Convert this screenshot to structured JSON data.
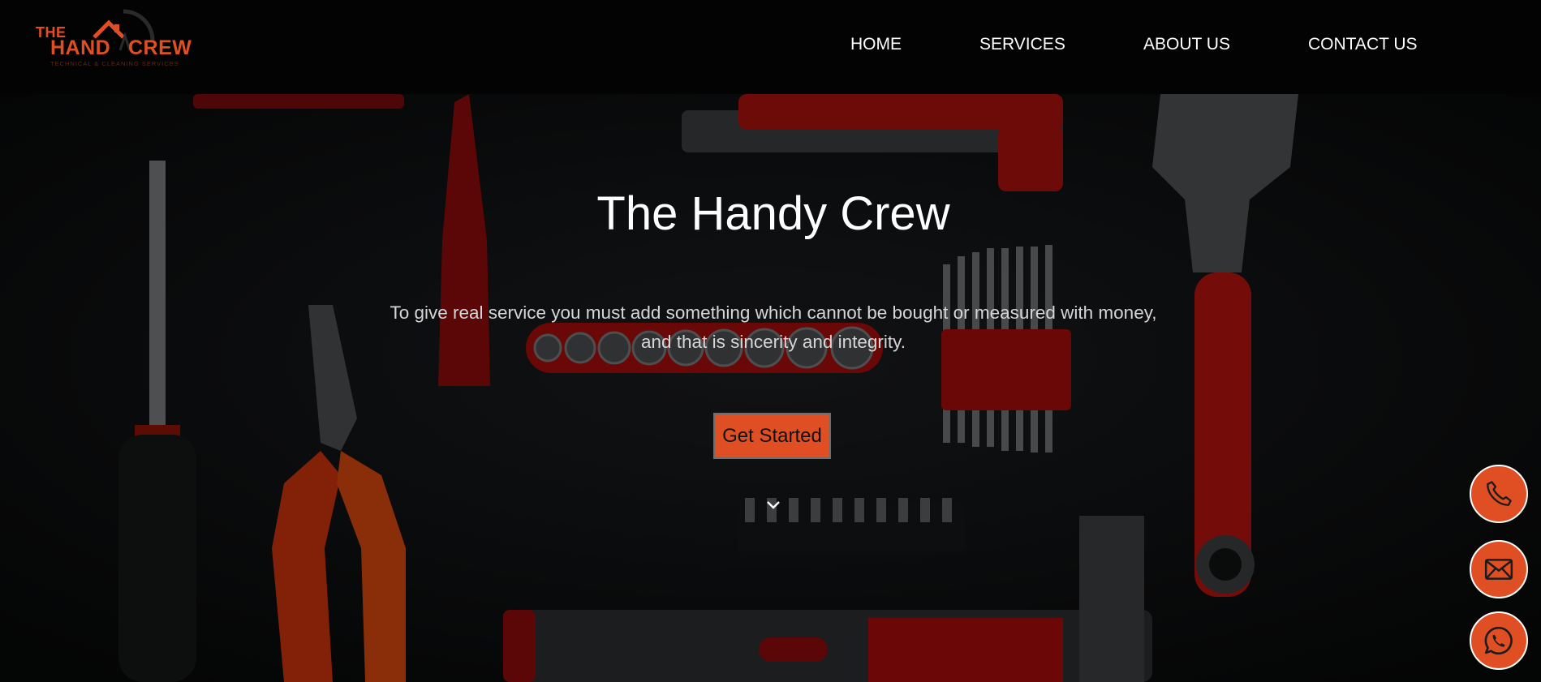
{
  "brand": {
    "logo_the": "THE",
    "logo_hand": "HAND",
    "logo_crew": "CREW",
    "logo_tagline": "TECHNICAL & CLEANING SERVICES",
    "accent_color": "#e04f24"
  },
  "nav": {
    "items": [
      {
        "label": "HOME"
      },
      {
        "label": "SERVICES"
      },
      {
        "label": "ABOUT US"
      },
      {
        "label": "CONTACT US"
      }
    ]
  },
  "hero": {
    "title": "The Handy Crew",
    "subtitle": "To give real service you must add something which cannot be bought or measured with money, and that is sincerity and integrity.",
    "cta_label": "Get Started",
    "scroll_icon": "chevron-down-icon"
  },
  "floating_actions": [
    {
      "icon": "phone-icon"
    },
    {
      "icon": "mail-icon"
    },
    {
      "icon": "whatsapp-icon"
    }
  ]
}
